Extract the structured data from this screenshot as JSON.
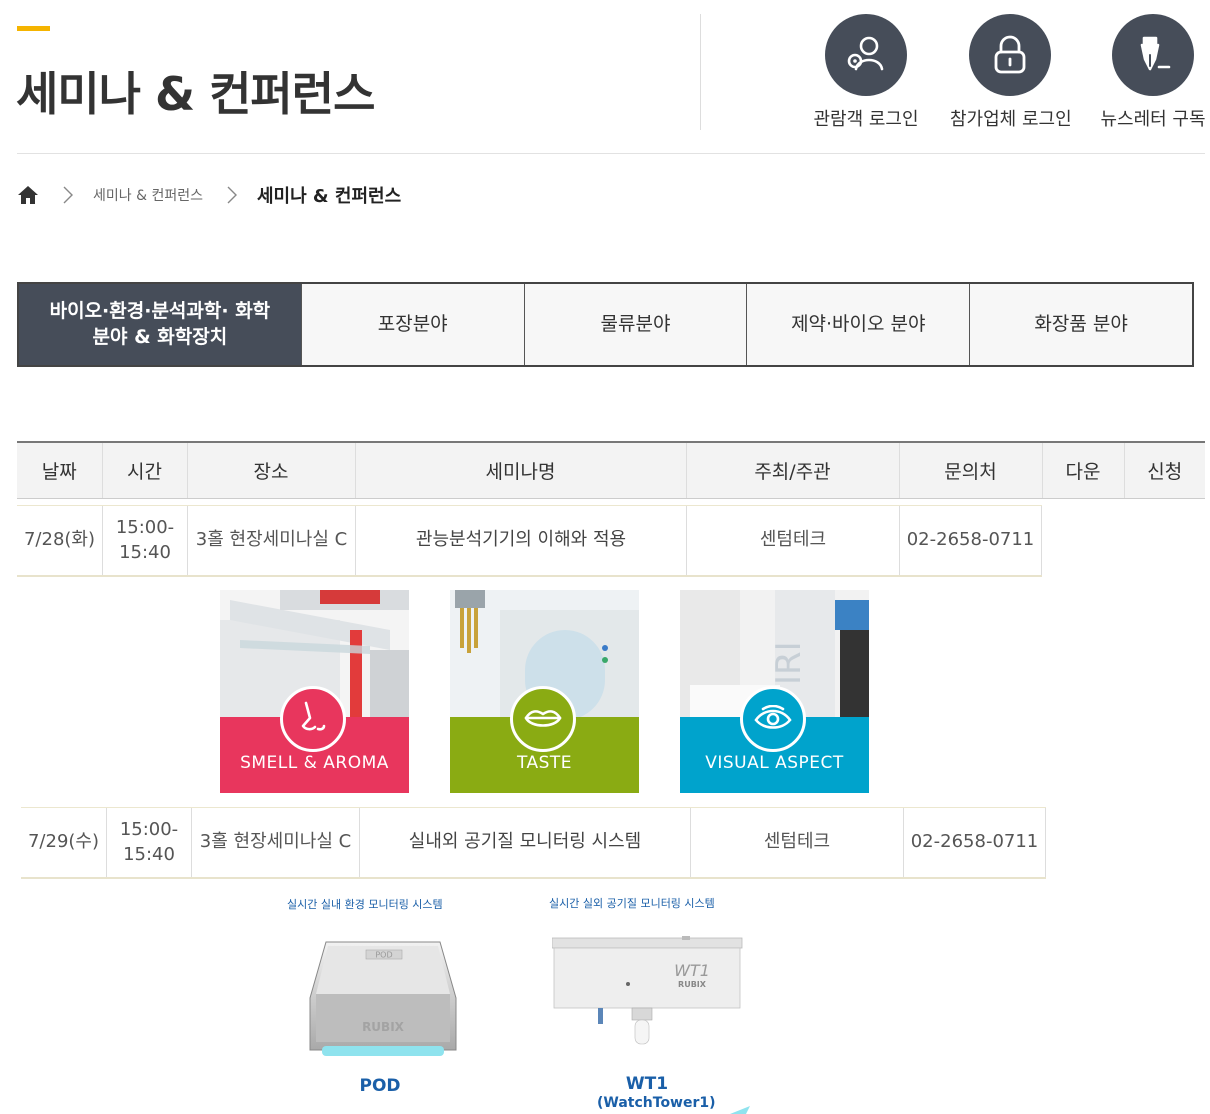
{
  "colors": {
    "accent": "#f5b400",
    "header_icon_bg": "#464d59",
    "active_tab": "#464d59",
    "smell": "#e8365d",
    "taste": "#8aab13",
    "visual": "#00a3cc",
    "product_text": "#1a5fa8"
  },
  "header": {
    "title": "세미나 & 컨퍼런스",
    "buttons": [
      {
        "label": "관람객 로그인",
        "icon": "visitor-login-icon"
      },
      {
        "label": "참가업체 로그인",
        "icon": "lock-icon"
      },
      {
        "label": "뉴스레터 구독",
        "icon": "pen-nib-icon"
      }
    ]
  },
  "breadcrumb": {
    "home_icon": "home-icon",
    "items": [
      "세미나 & 컨퍼런스",
      "세미나 & 컨퍼런스"
    ]
  },
  "tabs": [
    {
      "label": "바이오·환경·분석과학· 화학분야 & 화학장치",
      "active": true
    },
    {
      "label": "포장분야",
      "active": false
    },
    {
      "label": "물류분야",
      "active": false
    },
    {
      "label": "제약·바이오 분야",
      "active": false
    },
    {
      "label": "화장품 분야",
      "active": false
    }
  ],
  "table": {
    "headers": [
      "날짜",
      "시간",
      "장소",
      "세미나명",
      "주최/주관",
      "문의처",
      "다운",
      "신청"
    ],
    "rows": [
      {
        "date": "7/28(화)",
        "time": "15:00- 15:40",
        "place": "3홀 현장세미나실 C",
        "title": "관능분석기기의 이해와 적용",
        "host": "센텀테크",
        "contact": "02-2658-0711"
      },
      {
        "date": "7/29(수)",
        "time": "15:00- 15:40",
        "place": "3홀 현장세미나실 C",
        "title": "실내외 공기질 모니터링 시스템",
        "host": "센텀테크",
        "contact": "02-2658-0711"
      }
    ]
  },
  "senses": [
    {
      "label": "SMELL & AROMA",
      "icon": "nose-icon"
    },
    {
      "label": "TASTE",
      "icon": "lips-icon"
    },
    {
      "label": "VISUAL ASPECT",
      "icon": "eye-icon"
    }
  ],
  "products": [
    {
      "caption": "실시간 실내 환경 모니터링 시스템",
      "name": "POD",
      "device_text": "POD",
      "brand": "RUBIX"
    },
    {
      "caption": "실시간 실외 공기질 모니터링 시스템",
      "name": "WT1",
      "sub": "(WatchTower1)",
      "device_text": "WT1",
      "brand": "RUBIX"
    }
  ]
}
